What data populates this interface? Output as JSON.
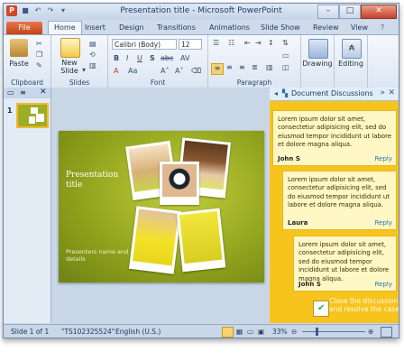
{
  "window": {
    "title": "Presentation title - Microsoft PowerPoint",
    "app_logo": "P"
  },
  "tabs": [
    "File",
    "Home",
    "Insert",
    "Design",
    "Transitions",
    "Animations",
    "Slide Show",
    "Review",
    "View"
  ],
  "ribbon": {
    "paste_label": "Paste",
    "new_slide_label": "New\nSlide",
    "new_slide_arrow": "▾",
    "font_name": "Calibri (Body)",
    "font_size": "12",
    "group_labels": {
      "clipboard": "Clipboard",
      "slides": "Slides",
      "font": "Font",
      "paragraph": "Paragraph"
    },
    "drawing_label": "Drawing",
    "editing_label": "Editing"
  },
  "left_pane": {
    "slide_number": "1"
  },
  "slide": {
    "title": "Presentation\ntitle",
    "subtitle": "Presenters name and\ndetails"
  },
  "task_pane": {
    "title": "Document Discussions",
    "comments": [
      {
        "text": "Lorem ipsum dolor sit amet, consectetur adipisicing elit, sed do eiusmod tempor incididunt ut labore et dolore magna aliqua.",
        "author": "John S",
        "reply": "Reply"
      },
      {
        "text": "Lorem ipsum dolor sit amet, consectetur adipisicing elit, sed do eiusmod tempor incididunt ut labore et dolore magna aliqua.",
        "author": "Laura",
        "reply": "Reply"
      },
      {
        "text": "Lorem ipsum dolor sit amet, consectetur adipisicing elit, sed do eiusmod tempor incididunt ut labore et dolore magna aliqua.",
        "author": "John S",
        "reply": "Reply"
      }
    ],
    "close_text": "Close the discussion\nand resolve the case"
  },
  "status": {
    "slide": "Slide 1 of 1",
    "theme": "\"TS102325524\"",
    "language": "English (U.S.)",
    "zoom": "33%"
  },
  "colors": {
    "file_tab": "#c3411c",
    "pane_yellow": "#f6c41c",
    "slide_green": "#9cae24"
  }
}
